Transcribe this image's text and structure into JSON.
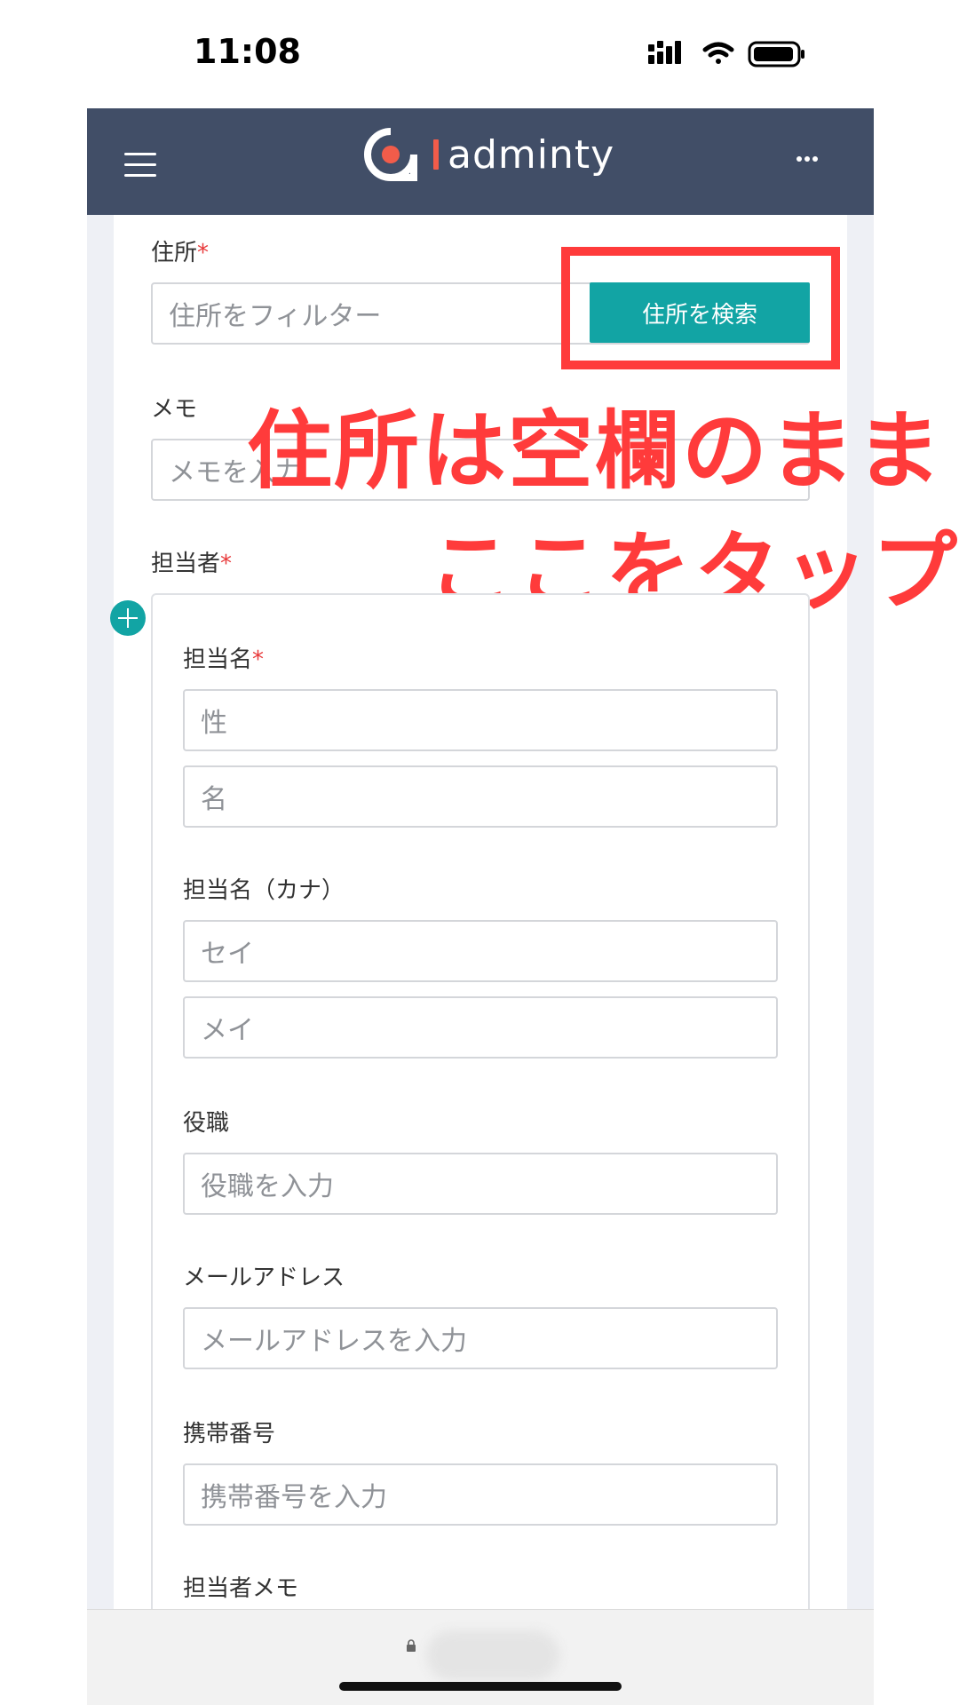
{
  "status_bar": {
    "time": "11:08"
  },
  "header": {
    "logo_text": "adminty"
  },
  "form": {
    "address": {
      "label": "住所",
      "required_mark": "*",
      "placeholder": "住所をフィルター",
      "search_button": "住所を検索"
    },
    "memo": {
      "label": "メモ",
      "placeholder": "メモを入力"
    },
    "contact": {
      "label": "担当者",
      "required_mark": "*",
      "name": {
        "label": "担当名",
        "required_mark": "*",
        "last_placeholder": "性",
        "first_placeholder": "名"
      },
      "name_kana": {
        "label": "担当名（カナ）",
        "last_placeholder": "セイ",
        "first_placeholder": "メイ"
      },
      "title": {
        "label": "役職",
        "placeholder": "役職を入力"
      },
      "email": {
        "label": "メールアドレス",
        "placeholder": "メールアドレスを入力"
      },
      "mobile": {
        "label": "携帯番号",
        "placeholder": "携帯番号を入力"
      },
      "contact_memo": {
        "label": "担当者メモ"
      }
    }
  },
  "annotation": {
    "line1": "住所は空欄のまま",
    "line2": "ここをタップ"
  },
  "colors": {
    "navbar": "#414e67",
    "accent": "#12a4a4",
    "annotation": "#ff3b3b",
    "required": "#e8393a",
    "logo_bar": "#f25c4a"
  }
}
